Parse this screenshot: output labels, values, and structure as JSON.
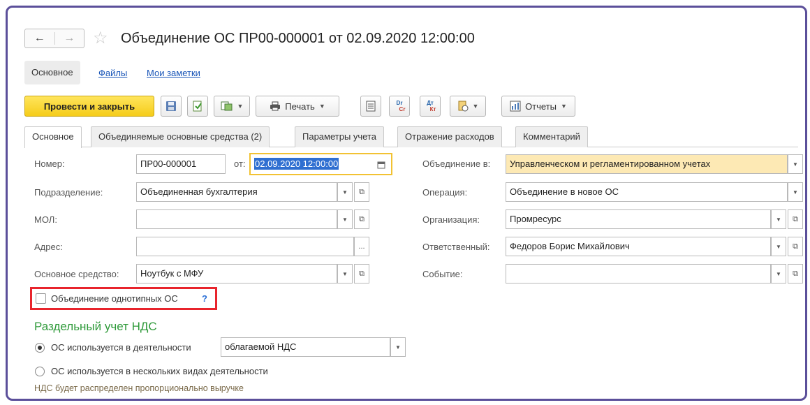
{
  "window": {
    "title": "Объединение ОС ПР00-000001 от 02.09.2020 12:00:00"
  },
  "nav": {
    "back": "←",
    "forward": "→",
    "star": "☆"
  },
  "top_links": {
    "main": "Основное",
    "files": "Файлы",
    "notes": "Мои заметки"
  },
  "toolbar": {
    "post_close": "Провести и закрыть",
    "print": "Печать",
    "reports": "Отчеты",
    "dr_cr_top": "Dr",
    "dr_cr_bottom": "Cr",
    "dt_kt_top": "Дт",
    "dt_kt_bottom": "Кт"
  },
  "tabs": [
    {
      "label": "Основное"
    },
    {
      "label": "Объединяемые основные средства (2)"
    },
    {
      "label": "Параметры учета"
    },
    {
      "label": "Отражение расходов"
    },
    {
      "label": "Комментарий"
    }
  ],
  "form": {
    "number_label": "Номер:",
    "number_value": "ПР00-000001",
    "from_label": "от:",
    "date_value": "02.09.2020 12:00:00",
    "unit_label": "Подразделение:",
    "unit_value": "Объединенная бухгалтерия",
    "mol_label": "МОЛ:",
    "mol_value": "",
    "address_label": "Адрес:",
    "address_value": "",
    "asset_label": "Основное средство:",
    "asset_value": "Ноутбук с МФУ",
    "merge_in_label": "Объединение в:",
    "merge_in_value": "Управленческом и регламентированном учетах",
    "operation_label": "Операция:",
    "operation_value": "Объединение в новое ОС",
    "org_label": "Организация:",
    "org_value": "Промресурс",
    "resp_label": "Ответственный:",
    "resp_value": "Федоров Борис Михайлович",
    "event_label": "Событие:",
    "event_value": "",
    "same_type_label": "Объединение однотипных ОС",
    "help": "?",
    "ellipsis": "..."
  },
  "vat": {
    "section_title": "Раздельный учет НДС",
    "option1": "ОС используется в деятельности",
    "option1_value": "облагаемой НДС",
    "option2": "ОС используется в нескольких видах деятельности",
    "note": "НДС будет распределен пропорционально выручке"
  },
  "colors": {
    "accent_yellow": "#f5cc1a",
    "highlight_field": "#fde9b4",
    "section_green": "#2f9a3a",
    "link_blue": "#1a56b8",
    "red_highlight": "#e8242c"
  }
}
